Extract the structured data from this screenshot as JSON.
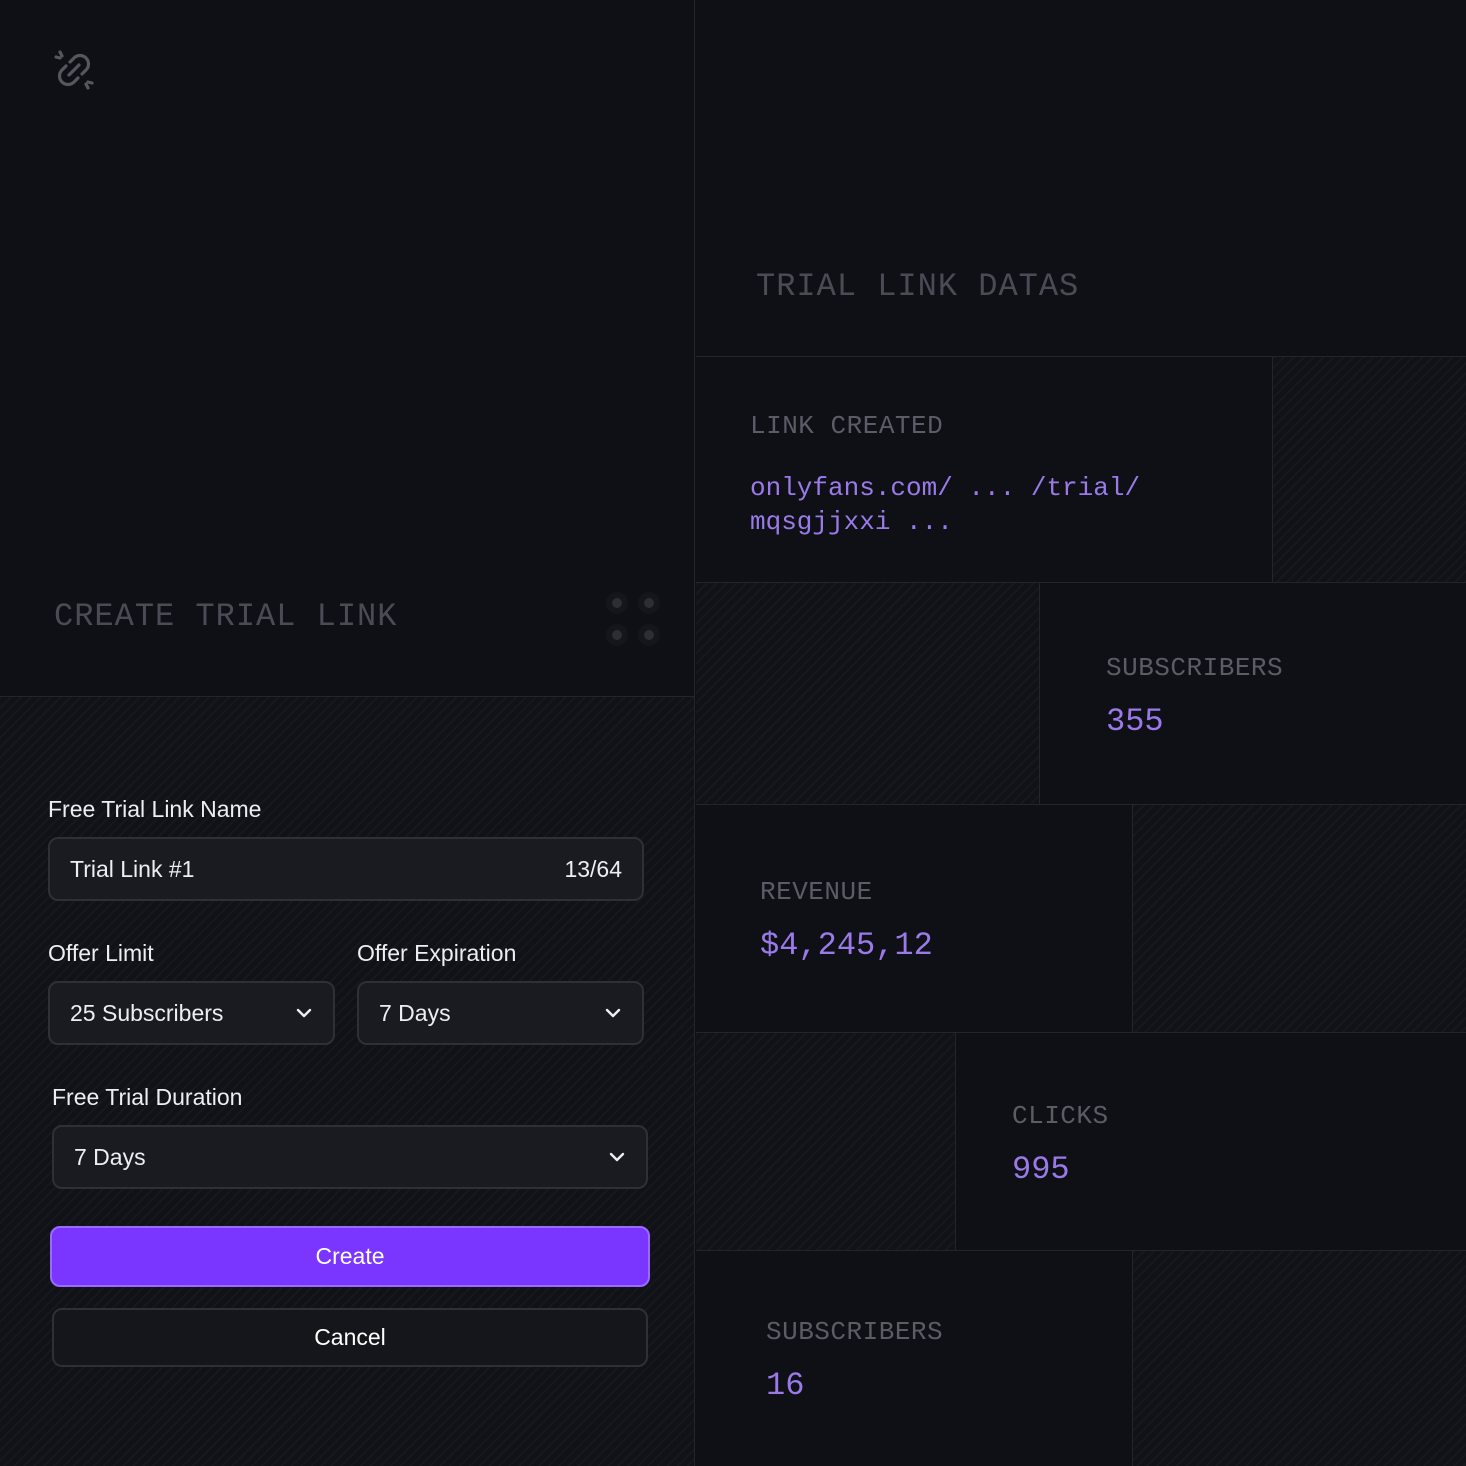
{
  "create": {
    "title": "CREATE TRIAL LINK",
    "name_label": "Free Trial Link Name",
    "name_value": "Trial Link #1",
    "name_counter": "13/64",
    "limit_label": "Offer Limit",
    "limit_value": "25 Subscribers",
    "expiration_label": "Offer Expiration",
    "expiration_value": "7 Days",
    "duration_label": "Free Trial Duration",
    "duration_value": "7 Days",
    "create_label": "Create",
    "cancel_label": "Cancel"
  },
  "data_panel": {
    "title": "TRIAL LINK DATAS",
    "link_label": "LINK CREATED",
    "link_line1": "onlyfans.com/ ... /trial/",
    "link_line2": "mqsgjjxxi ...",
    "subscribers_label": "SUBSCRIBERS",
    "subscribers_value": "355",
    "revenue_label": "REVENUE",
    "revenue_value": "$4,245,12",
    "clicks_label": "CLICKS",
    "clicks_value": "995",
    "subscribers2_label": "SUBSCRIBERS",
    "subscribers2_value": "16"
  },
  "colors": {
    "accent": "#7a35ff",
    "value_purple": "#9a7ae8",
    "background": "#0f1016"
  },
  "icons": [
    "broken-link-icon",
    "grip-dots-icon",
    "chevron-down-icon"
  ]
}
